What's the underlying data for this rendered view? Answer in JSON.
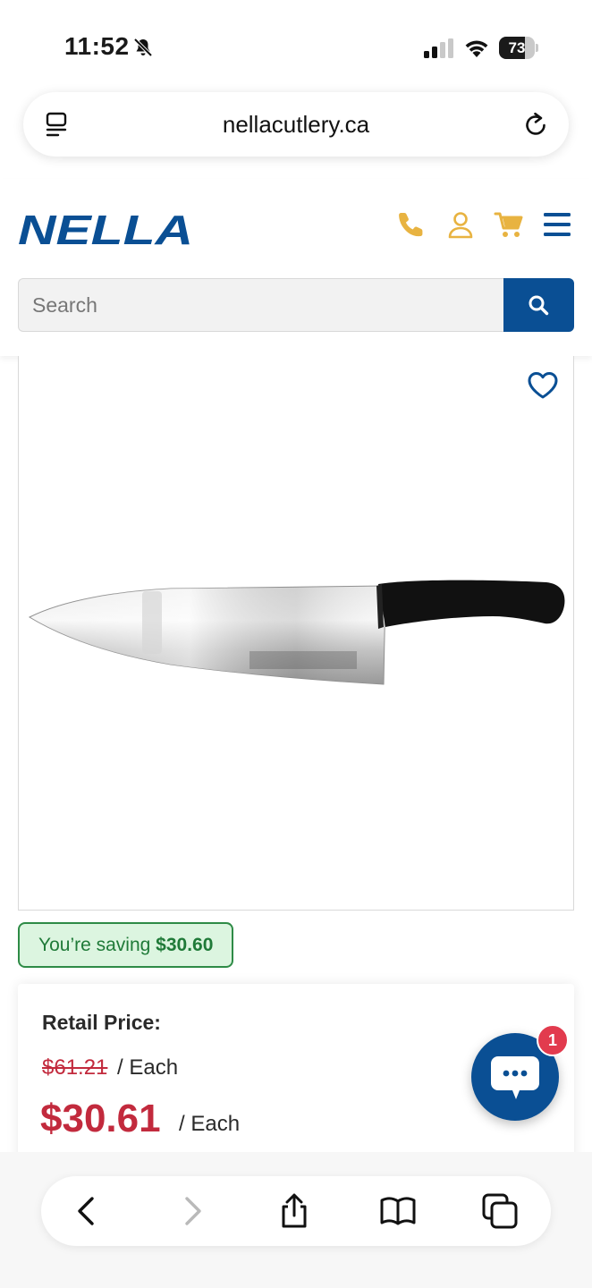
{
  "status_bar": {
    "time": "11:52",
    "battery_level": "73"
  },
  "browser": {
    "url": "nellacutlery.ca"
  },
  "site": {
    "logo_text": "NELLA",
    "search_placeholder": "Search",
    "brand_blue": "#0a4f94",
    "icon_gold": "#e8b341"
  },
  "product": {
    "image_alt": "Chef knife with black handle",
    "saving_prefix": "You’re saving ",
    "saving_amount": "$30.60",
    "retail_label": "Retail Price:",
    "old_price": "$61.21",
    "old_unit": "/ Each",
    "sale_price": "$30.61",
    "sale_unit": "/ Each",
    "sale_color": "#c22a3d"
  },
  "chat": {
    "badge_count": "1"
  },
  "toolbar": {
    "icons": [
      "back-icon",
      "forward-icon",
      "share-icon",
      "bookmarks-icon",
      "tabs-icon"
    ]
  }
}
